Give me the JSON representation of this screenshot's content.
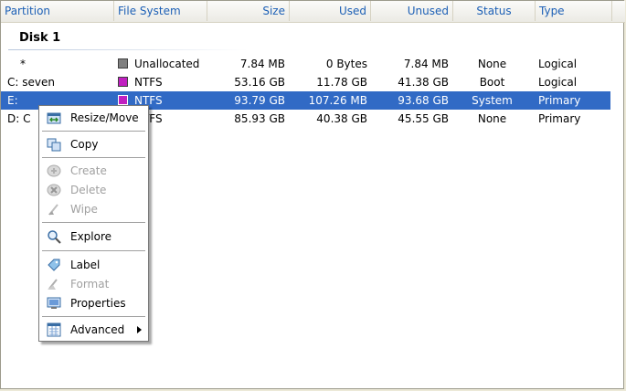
{
  "columns": [
    {
      "label": "Partition"
    },
    {
      "label": "File System"
    },
    {
      "label": "Size"
    },
    {
      "label": "Used"
    },
    {
      "label": "Unused"
    },
    {
      "label": "Status"
    },
    {
      "label": "Type"
    }
  ],
  "disk": {
    "title": "Disk 1"
  },
  "rows": [
    {
      "partition": "*",
      "fs": "Unallocated",
      "fs_color": "#808080",
      "size": "7.84 MB",
      "used": "0 Bytes",
      "unused": "7.84 MB",
      "status": "None",
      "type": "Logical"
    },
    {
      "partition": "C: seven",
      "fs": "NTFS",
      "fs_color": "#c020c0",
      "size": "53.16 GB",
      "used": "11.78 GB",
      "unused": "41.38 GB",
      "status": "Boot",
      "type": "Logical"
    },
    {
      "partition": "E:",
      "fs": "NTFS",
      "fs_color": "#c020c0",
      "size": "93.79 GB",
      "used": "107.26 MB",
      "unused": "93.68 GB",
      "status": "System",
      "type": "Primary"
    },
    {
      "partition": "D: C",
      "fs": "NTFS",
      "fs_color": "#c020c0",
      "size": "85.93 GB",
      "used": "40.38 GB",
      "unused": "45.55 GB",
      "status": "None",
      "type": "Primary"
    }
  ],
  "selected_row": 2,
  "context_menu": {
    "items": [
      {
        "label": "Resize/Move",
        "icon": "resize-icon",
        "enabled": true
      },
      {
        "label": "Copy",
        "icon": "copy-icon",
        "enabled": true
      },
      {
        "label": "Create",
        "icon": "create-icon",
        "enabled": false
      },
      {
        "label": "Delete",
        "icon": "delete-icon",
        "enabled": false
      },
      {
        "label": "Wipe",
        "icon": "wipe-icon",
        "enabled": false
      },
      {
        "label": "Explore",
        "icon": "explore-icon",
        "enabled": true
      },
      {
        "label": "Label",
        "icon": "label-icon",
        "enabled": true
      },
      {
        "label": "Format",
        "icon": "format-icon",
        "enabled": false
      },
      {
        "label": "Properties",
        "icon": "properties-icon",
        "enabled": true
      },
      {
        "label": "Advanced",
        "icon": "advanced-icon",
        "enabled": true,
        "submenu": true
      }
    ]
  },
  "colors": {
    "selection": "#316ac5",
    "header_text": "#1d60b6"
  }
}
